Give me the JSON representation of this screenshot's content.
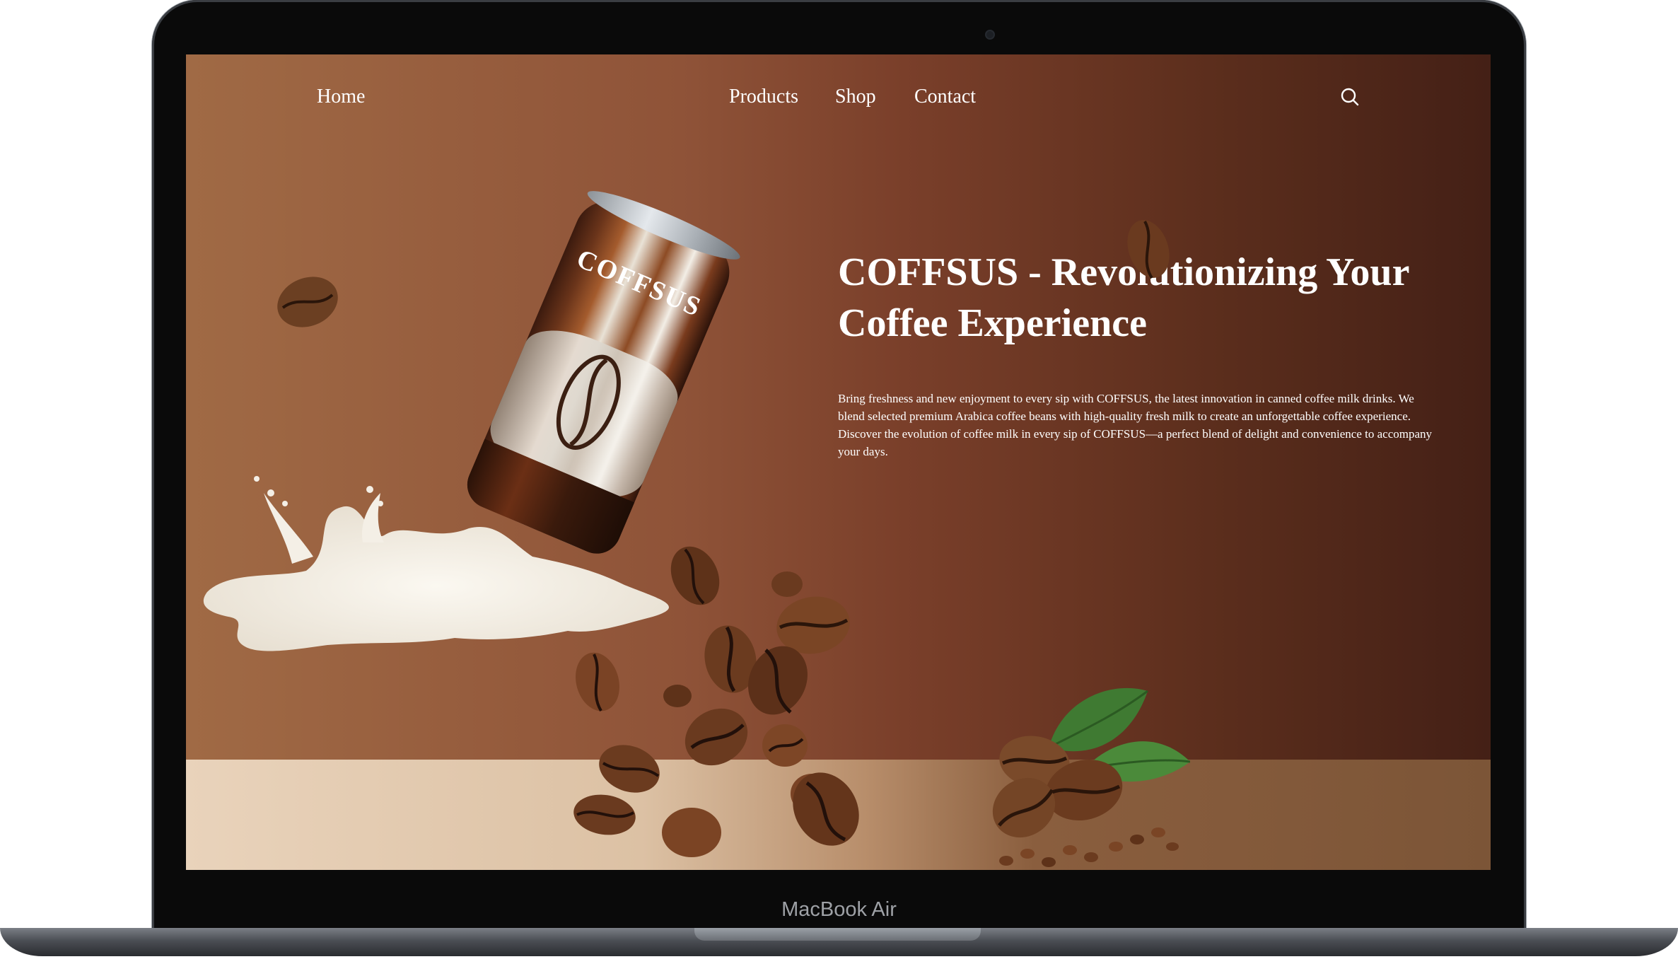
{
  "device": {
    "label": "MacBook Air"
  },
  "nav": {
    "home": "Home",
    "products": "Products",
    "shop": "Shop",
    "contact": "Contact",
    "search_icon": "search-icon"
  },
  "hero": {
    "title": "COFFSUS - Revolutionizing Your Coffee Experience",
    "description": "Bring freshness and new enjoyment to every sip with COFFSUS, the latest innovation in canned coffee milk drinks. We blend selected premium Arabica coffee beans with high-quality fresh milk to create an unforgettable coffee experience. Discover the evolution of coffee milk in every sip of COFFSUS—a perfect blend of delight and convenience to accompany your days."
  },
  "product": {
    "can_brand": "COFFSUS"
  },
  "colors": {
    "background_left": "#a06a45",
    "background_right": "#442016",
    "text": "#ffffff",
    "floor": "#e9d3bb"
  }
}
